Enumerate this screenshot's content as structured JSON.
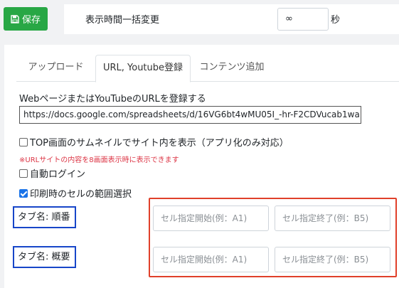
{
  "toolbar": {
    "save_label": "保存",
    "save_icon": "save-icon",
    "accent": "#28a745"
  },
  "display_time": {
    "label": "表示時間一括変更",
    "value": "∞",
    "unit": "秒"
  },
  "tabs": [
    {
      "label": "アップロード",
      "active": false
    },
    {
      "label": "URL, Youtube登録",
      "active": true
    },
    {
      "label": "コンテンツ追加",
      "active": false
    }
  ],
  "url_form": {
    "label": "WebページまたはYouTubeのURLを登録する",
    "value": "https://docs.google.com/spreadsheets/d/16VG6bt4wMU05I_-hr-F2CDVucab1wa"
  },
  "options": {
    "thumbnail": {
      "label": "TOP画面のサムネイルでサイト内を表示（アプリ化のみ対応）",
      "checked": false
    },
    "notice": "※URLサイトの内容を8画面表示時に表示できます",
    "auto_login": {
      "label": "自動ログイン",
      "checked": false
    },
    "print_range": {
      "label": "印刷時のセルの範囲選択",
      "checked": true
    }
  },
  "range_rows": [
    {
      "tab_name": "タブ名: 順番",
      "start_placeholder": "セル指定開始(例：A1)",
      "end_placeholder": "セル指定終了(例：B5)"
    },
    {
      "tab_name": "タブ名: 概要",
      "start_placeholder": "セル指定開始(例：A1)",
      "end_placeholder": "セル指定終了(例：B5)"
    }
  ],
  "colors": {
    "highlight_blue": "#1746c9",
    "highlight_red": "#e0402a",
    "notice_red": "#dc3545"
  }
}
